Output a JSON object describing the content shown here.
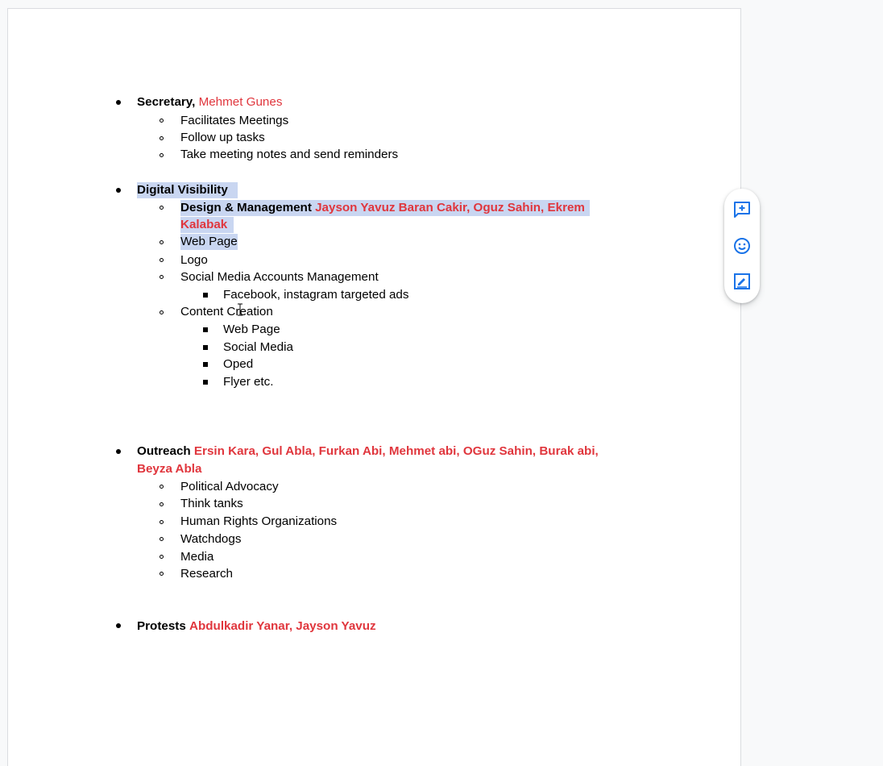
{
  "doc": {
    "secretary": {
      "label": "Secretary,",
      "name": "Mehmet Gunes",
      "items": [
        "Facilitates Meetings",
        "Follow up tasks",
        "Take meeting notes and send reminders"
      ]
    },
    "digital": {
      "label": "Digital Visibility",
      "design_label": "Design & Management",
      "design_names_line1": "Jayson Yavuz Baran Cakir, Oguz Sahin, Ekrem",
      "design_names_line2": "Kalabak",
      "items": [
        "Web Page",
        "Logo",
        "Social Media Accounts Management"
      ],
      "social_sub": [
        "Facebook, instagram targeted ads"
      ],
      "content_label": "Content Creation",
      "content_sub": [
        "Web Page",
        "Social Media",
        "Oped",
        "Flyer etc."
      ]
    },
    "outreach": {
      "label": "Outreach",
      "names_line1": "Ersin Kara, Gul Abla,  Furkan Abi, Mehmet abi, OGuz Sahin, Burak abi,",
      "names_line2": "Beyza Abla",
      "items": [
        "Political Advocacy",
        "Think tanks",
        "Human Rights Organizations",
        "Watchdogs",
        "Media",
        "Research"
      ]
    },
    "protests": {
      "label": "Protests",
      "names": "Abdulkadir Yanar, Jayson Yavuz"
    }
  },
  "side_actions": {
    "add_comment_icon": "add-comment-icon",
    "emoji_icon": "emoji-reaction-icon",
    "suggest_edit_icon": "suggest-edit-icon",
    "accent": "#1a73e8"
  },
  "colors": {
    "name_red": "#e0363d",
    "selection": "#c9d6f1"
  }
}
